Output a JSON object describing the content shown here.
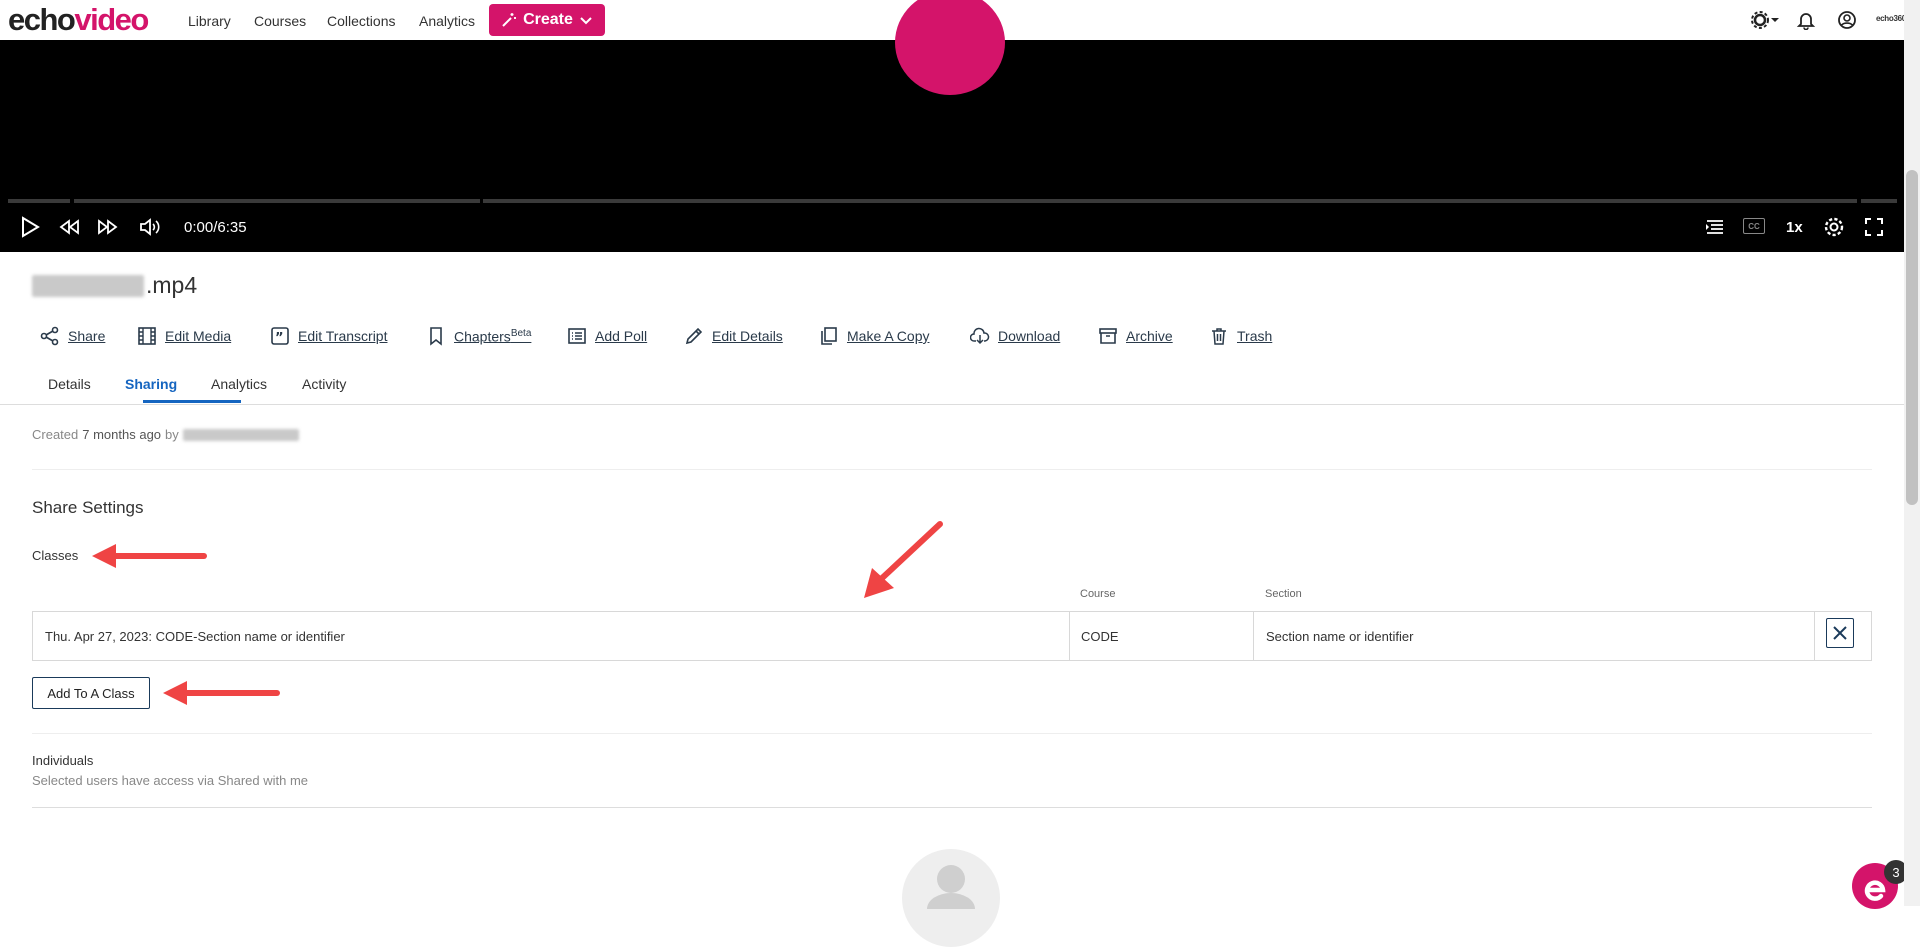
{
  "nav": {
    "logo_part1": "echo",
    "logo_part2": "video",
    "links": [
      "Library",
      "Courses",
      "Collections",
      "Analytics"
    ],
    "create_label": "Create",
    "brand_badge": "echo360"
  },
  "player": {
    "time": "0:00/6:35",
    "speed": "1x",
    "cc": "CC"
  },
  "media": {
    "title_suffix": ".mp4"
  },
  "actions": [
    {
      "label": "Share",
      "icon": "share-icon"
    },
    {
      "label": "Edit Media",
      "icon": "film-icon"
    },
    {
      "label": "Edit Transcript",
      "icon": "quote-icon"
    },
    {
      "label": "Chapters",
      "sup": "Beta",
      "icon": "bookmark-icon"
    },
    {
      "label": "Add Poll",
      "icon": "list-icon"
    },
    {
      "label": "Edit Details",
      "icon": "pencil-icon"
    },
    {
      "label": "Make A Copy",
      "icon": "copy-icon"
    },
    {
      "label": "Download",
      "icon": "cloud-download-icon"
    },
    {
      "label": "Archive",
      "icon": "archive-icon"
    },
    {
      "label": "Trash",
      "icon": "trash-icon"
    }
  ],
  "tabs": [
    "Details",
    "Sharing",
    "Analytics",
    "Activity"
  ],
  "created": {
    "prefix": "Created",
    "ago": "7 months ago",
    "by": "by"
  },
  "share": {
    "heading": "Share Settings",
    "classes_label": "Classes",
    "col_course": "Course",
    "col_section": "Section",
    "row": {
      "name": "Thu. Apr 27, 2023: CODE-Section name or identifier",
      "course": "CODE",
      "section": "Section name or identifier"
    },
    "add_button": "Add To A Class",
    "individuals_label": "Individuals",
    "individuals_hint": "Selected users have access via Shared with me"
  },
  "chat": {
    "badge": "3"
  },
  "colors": {
    "brand": "#d4146a",
    "accent": "#1565c0",
    "arrow": "#ef4444"
  }
}
